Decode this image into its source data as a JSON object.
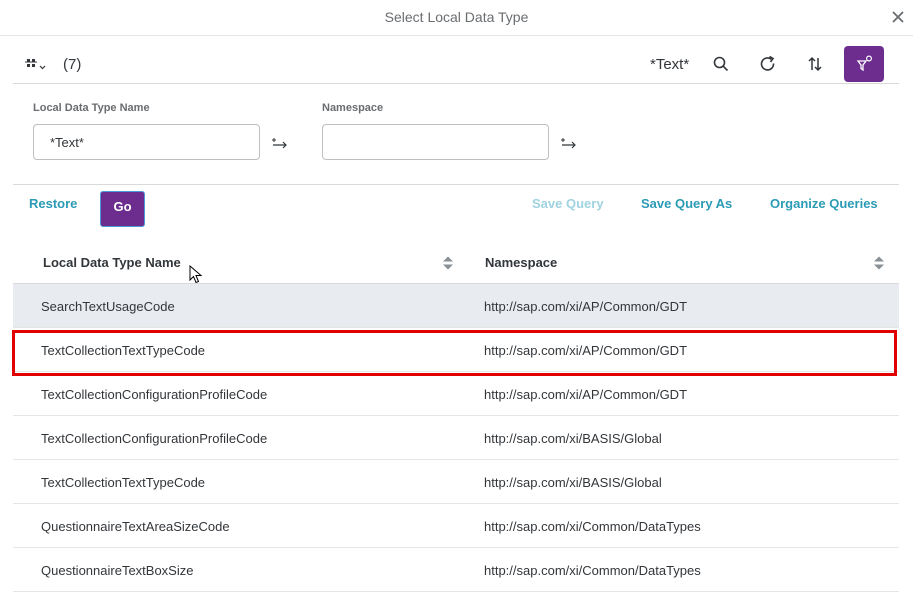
{
  "dialog": {
    "title": "Select Local Data Type"
  },
  "toolbar": {
    "count": "(7)",
    "search_value": "*Text*"
  },
  "filters": [
    {
      "label": "Local Data Type Name",
      "value": "*Text*",
      "placeholder": ""
    },
    {
      "label": "Namespace",
      "value": "",
      "placeholder": ""
    }
  ],
  "actions": {
    "restore": "Restore",
    "go": "Go",
    "save_query": "Save Query",
    "save_query_as": "Save Query As",
    "organize_queries": "Organize Queries"
  },
  "table": {
    "columns": [
      "Local Data Type Name",
      "Namespace"
    ],
    "rows": [
      {
        "name": "SearchTextUsageCode",
        "namespace": "http://sap.com/xi/AP/Common/GDT"
      },
      {
        "name": "TextCollectionTextTypeCode",
        "namespace": "http://sap.com/xi/AP/Common/GDT"
      },
      {
        "name": "TextCollectionConfigurationProfileCode",
        "namespace": "http://sap.com/xi/AP/Common/GDT"
      },
      {
        "name": "TextCollectionConfigurationProfileCode",
        "namespace": "http://sap.com/xi/BASIS/Global"
      },
      {
        "name": "TextCollectionTextTypeCode",
        "namespace": "http://sap.com/xi/BASIS/Global"
      },
      {
        "name": "QuestionnaireTextAreaSizeCode",
        "namespace": "http://sap.com/xi/Common/DataTypes"
      },
      {
        "name": "QuestionnaireTextBoxSize",
        "namespace": "http://sap.com/xi/Common/DataTypes"
      }
    ]
  },
  "colors": {
    "accent": "#6c2d8f",
    "link": "#2b9bb5",
    "highlight": "#e00000"
  },
  "icons": [
    "close-icon",
    "variant-icon",
    "search-icon",
    "refresh-icon",
    "sort-icon",
    "filter-icon",
    "value-help-icon"
  ]
}
